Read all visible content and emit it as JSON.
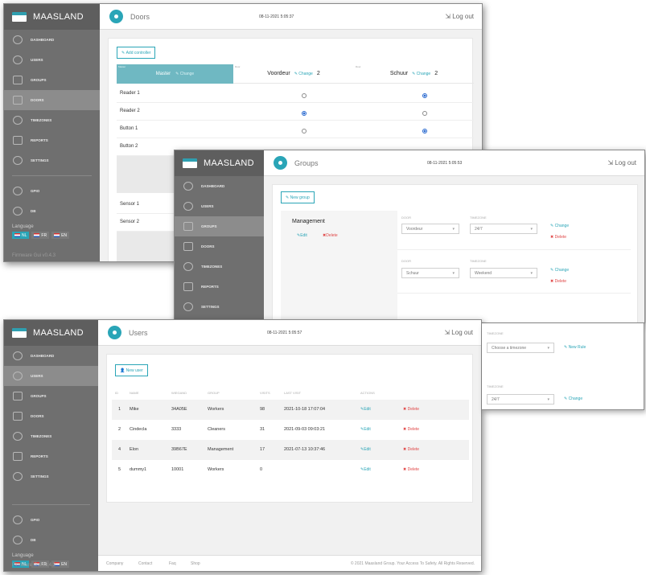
{
  "brand": "MAASLAND",
  "version": "Firmware Gui v0.4.3",
  "languages": {
    "label": "Language",
    "items": [
      "NL",
      "FR",
      "EN"
    ]
  },
  "nav": {
    "dashboard": "Dashboard",
    "users": "Users",
    "groups": "Groups",
    "doors": "Doors",
    "timezones": "Timezones",
    "reports": "Reports",
    "settings": "Settings",
    "gpio": "GPIO",
    "db": "DB"
  },
  "logout": "Log out",
  "doors": {
    "title": "Doors",
    "clock": "08-11-2021 5:05:37",
    "add_button": "Add controller",
    "master": {
      "badge": "Master",
      "title": "Master",
      "change": "Change"
    },
    "columns": [
      {
        "tag": "Door",
        "name": "Voordeur",
        "change": "Change",
        "count": "2"
      },
      {
        "tag": "Door",
        "name": "Schuur",
        "change": "Change",
        "count": "2"
      }
    ],
    "rows": [
      {
        "label": "Reader 1"
      },
      {
        "label": "Reader 2"
      },
      {
        "label": "Button 1"
      },
      {
        "label": "Button 2"
      },
      {
        "label": "Sensor 1"
      },
      {
        "label": "Sensor 2"
      }
    ],
    "radio_states": [
      [
        false,
        true
      ],
      [
        true,
        false
      ],
      [
        false,
        true
      ]
    ]
  },
  "groups": {
    "title": "Groups",
    "clock": "08-11-2021 5:05:53",
    "add_button": "New group",
    "group_name": "Management",
    "edit": "Edit",
    "delete": "Delete",
    "door_label": "Door",
    "timezone_label": "Timezone",
    "rules": [
      {
        "door": "Voordeur",
        "timezone": "24/7",
        "action": "Change",
        "delete": "Delete"
      },
      {
        "door": "Schuur",
        "timezone": "Weekend",
        "action": "Change",
        "delete": "Delete"
      }
    ],
    "new_rule": {
      "timezone_placeholder": "Choose a timezone",
      "action": "New Rule"
    },
    "rule4": {
      "timezone": "24/7",
      "action": "Change"
    }
  },
  "users": {
    "title": "Users",
    "clock": "08-11-2021 5:05:57",
    "add_button": "New user",
    "headers": [
      "ID",
      "Name",
      "Wiegand",
      "Group",
      "Visits",
      "Last visit",
      "Actions"
    ],
    "rows": [
      {
        "id": "1",
        "name": "Mike",
        "wiegand": "34A05E",
        "group": "Workers",
        "visits": "98",
        "last": "2021-10-18 17:07:04",
        "edit": "Edit",
        "delete": "Delete"
      },
      {
        "id": "2",
        "name": "Cindecla",
        "wiegand": "3333",
        "group": "Cleaners",
        "visits": "31",
        "last": "2021-09-03 09:03:21",
        "edit": "Edit",
        "delete": "Delete"
      },
      {
        "id": "4",
        "name": "Elon",
        "wiegand": "39B67E",
        "group": "Management",
        "visits": "17",
        "last": "2021-07-13 10:37:46",
        "edit": "Edit",
        "delete": "Delete"
      },
      {
        "id": "5",
        "name": "dummy1",
        "wiegand": "10001",
        "group": "Workers",
        "visits": "0",
        "last": "",
        "edit": "Edit",
        "delete": "Delete"
      }
    ],
    "footer_links": [
      "Company",
      "Contact",
      "Faq",
      "Shop"
    ],
    "copyright": "© 2021 Maasland Group. Your Access To Safety. All Rights Reserved."
  },
  "colors": {
    "accent": "#2aa5b7",
    "sidebar": "#6f6f6f",
    "danger": "#e04848"
  }
}
